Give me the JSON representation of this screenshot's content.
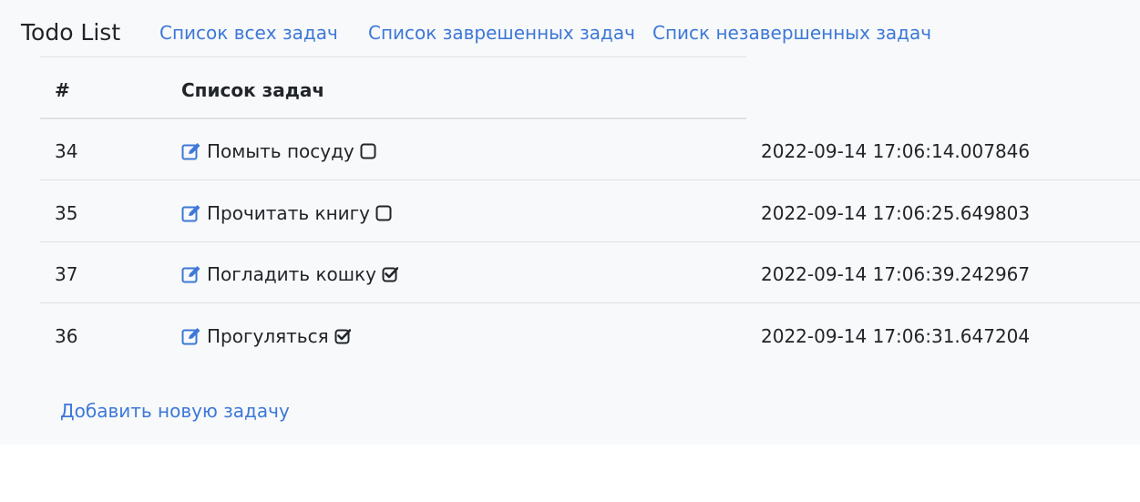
{
  "brand": "Todo List",
  "nav": {
    "all": "Список всех задач",
    "done": "Списoк заврешенных задач",
    "undone": "Списк незавершенных задач"
  },
  "table": {
    "headers": [
      "#",
      "Список задач"
    ],
    "rows": [
      {
        "id": "34",
        "task": "Помыть посуду",
        "done": false,
        "date": "2022-09-14 17:06:14.007846"
      },
      {
        "id": "35",
        "task": "Прочитать книгу",
        "done": false,
        "date": "2022-09-14 17:06:25.649803"
      },
      {
        "id": "37",
        "task": "Погладить кошку",
        "done": true,
        "date": "2022-09-14 17:06:39.242967"
      },
      {
        "id": "36",
        "task": "Прогуляться",
        "done": true,
        "date": "2022-09-14 17:06:31.647204"
      }
    ]
  },
  "add_link": "Добавить новую задачу",
  "colors": {
    "link": "#3d78d8",
    "text": "#212529",
    "background": "#f8f9fa",
    "border": "#dee2e6"
  },
  "icons": {
    "edit": "edit-icon",
    "unchecked": "square-icon",
    "checked": "check-square-icon"
  }
}
